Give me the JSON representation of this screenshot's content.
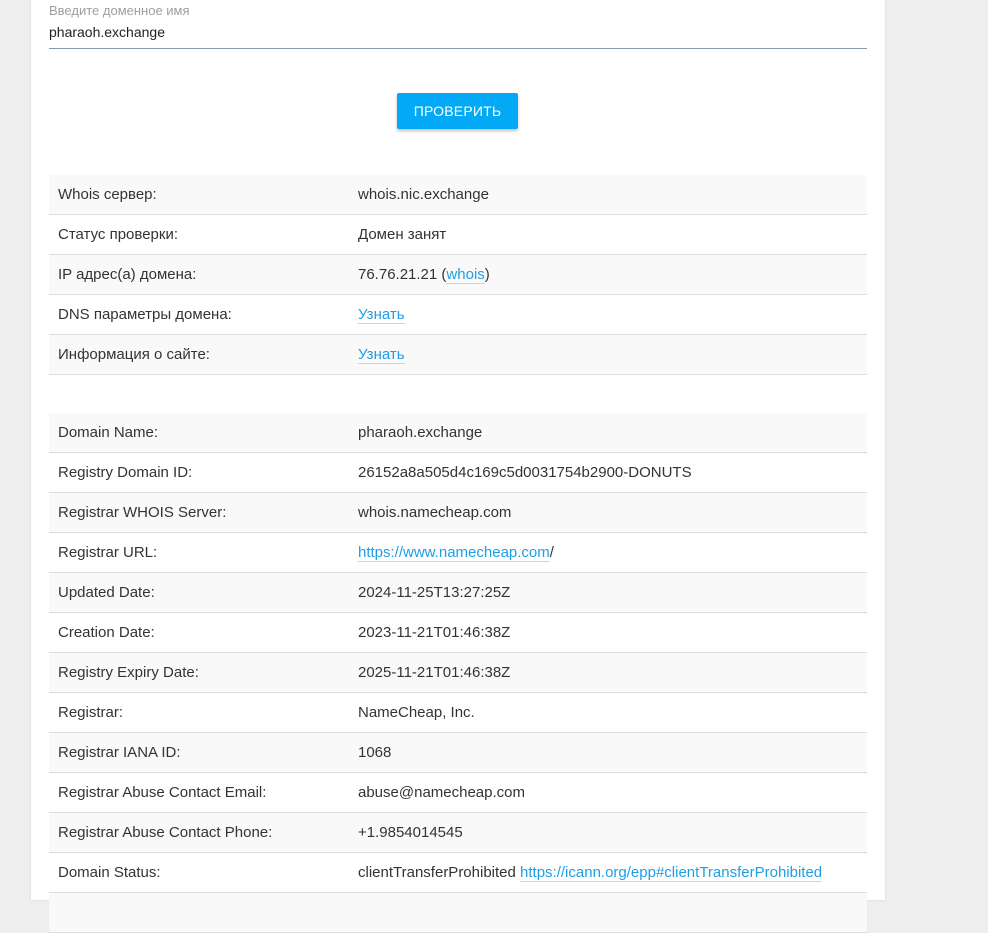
{
  "search": {
    "label": "Введите доменное имя",
    "value": "pharaoh.exchange",
    "button_label": "ПРОВЕРИТЬ"
  },
  "check": {
    "rows": [
      {
        "key": "Whois сервер:",
        "value": "whois.nic.exchange"
      },
      {
        "key": "Статус проверки:",
        "value": "Домен занят"
      },
      {
        "key": "IP адрес(а) домена:",
        "ip": "76.76.21.21",
        "open": " (",
        "link": "whois",
        "close": ")"
      },
      {
        "key": "DNS параметры домена:",
        "link": "Узнать"
      },
      {
        "key": "Информация о сайте:",
        "link": "Узнать"
      }
    ]
  },
  "whois": {
    "rows": [
      {
        "key": "Domain Name:",
        "value": "pharaoh.exchange"
      },
      {
        "key": "Registry Domain ID:",
        "value": "26152a8a505d4c169c5d0031754b2900-DONUTS"
      },
      {
        "key": "Registrar WHOIS Server:",
        "value": "whois.namecheap.com"
      },
      {
        "key": "Registrar URL:",
        "link": "https://www.namecheap.com",
        "suffix": "/"
      },
      {
        "key": "Updated Date:",
        "value": "2024-11-25T13:27:25Z"
      },
      {
        "key": "Creation Date:",
        "value": "2023-11-21T01:46:38Z"
      },
      {
        "key": "Registry Expiry Date:",
        "value": "2025-11-21T01:46:38Z"
      },
      {
        "key": "Registrar:",
        "value": "NameCheap, Inc."
      },
      {
        "key": "Registrar IANA ID:",
        "value": "1068"
      },
      {
        "key": "Registrar Abuse Contact Email:",
        "value": "abuse@namecheap.com"
      },
      {
        "key": "Registrar Abuse Contact Phone:",
        "value": "+1.9854014545"
      },
      {
        "key": "Domain Status:",
        "value": "clientTransferProhibited ",
        "link": "https://icann.org/epp#clientTransferProhibited"
      },
      {
        "key": "",
        "value": ""
      }
    ]
  },
  "colors": {
    "accent": "#03a9f4",
    "link": "#1e9ee6",
    "background": "#eeeeee"
  }
}
